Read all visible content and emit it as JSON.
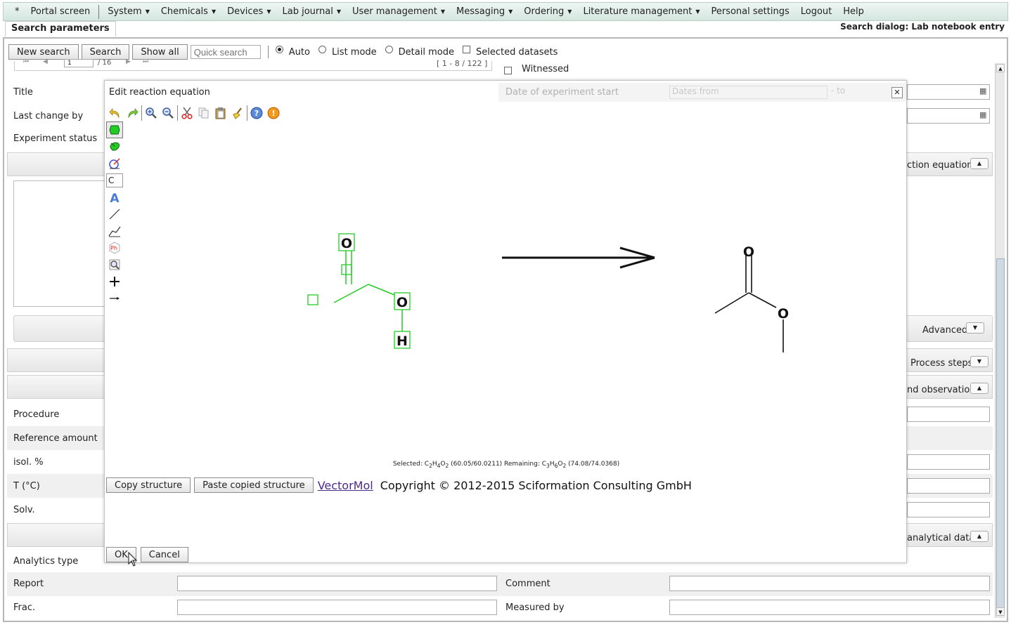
{
  "menu": {
    "items": [
      {
        "label": "*",
        "has_caret": false
      },
      {
        "label": "Portal screen",
        "has_caret": false
      },
      {
        "label": "System",
        "has_caret": true
      },
      {
        "label": "Chemicals",
        "has_caret": true
      },
      {
        "label": "Devices",
        "has_caret": true
      },
      {
        "label": "Lab journal",
        "has_caret": true
      },
      {
        "label": "User management",
        "has_caret": true
      },
      {
        "label": "Messaging",
        "has_caret": true
      },
      {
        "label": "Ordering",
        "has_caret": true
      },
      {
        "label": "Literature management",
        "has_caret": true
      },
      {
        "label": "Personal settings",
        "has_caret": false
      },
      {
        "label": "Logout",
        "has_caret": false
      },
      {
        "label": "Help",
        "has_caret": false
      }
    ]
  },
  "tabs": {
    "search_parameters": "Search parameters",
    "dialog_title": "Search dialog: Lab notebook entry"
  },
  "toolbar": {
    "new_search": "New search",
    "search": "Search",
    "show_all": "Show all",
    "quick_search_placeholder": "Quick search",
    "auto": "Auto",
    "list_mode": "List mode",
    "detail_mode": "Detail mode",
    "selected_datasets": "Selected datasets"
  },
  "pager": {
    "page": "1",
    "total_pages": "/ 16",
    "range": "[ 1 - 8 / 122 ]"
  },
  "form": {
    "witnessed": "Witnessed",
    "title": "Title",
    "last_change_by": "Last change by",
    "experiment_status": "Experiment status",
    "reaction_equation": "ction equation",
    "advanced": "Advanced",
    "process_steps": "Process steps",
    "observation": "nd observation",
    "procedure": "Procedure",
    "reference_amount": "Reference amount",
    "isol": "isol. %",
    "temp": "T (°C)",
    "solv": "Solv.",
    "analytical_data": "analytical data",
    "analytics_type": "Analytics type",
    "report": "Report",
    "comment": "Comment",
    "frac": "Frac.",
    "measured_by": "Measured by"
  },
  "dialog": {
    "title": "Edit reaction equation",
    "ghost_label": "Date of experiment start",
    "ghost_from": "Dates from",
    "ghost_to": "- to",
    "atom_symbol": "C",
    "atoms": {
      "o": "O",
      "h": "H"
    },
    "formula": {
      "selected_label": "Selected: ",
      "selected_formula": [
        "C",
        "2",
        "H",
        "4",
        "O",
        "2"
      ],
      "selected_mass": " (60.05/60.0211) ",
      "remaining_label": "Remaining: ",
      "remaining_formula": [
        "C",
        "3",
        "H",
        "6",
        "O",
        "2"
      ],
      "remaining_mass": " (74.08/74.0368)"
    },
    "copy_structure": "Copy structure",
    "paste_structure": "Paste copied structure",
    "vectormol_link": "VectorMol",
    "copyright": "Copyright © 2012-2015 Sciformation Consulting GmbH",
    "ok": "OK",
    "cancel": "Cancel"
  },
  "colors": {
    "selection_green": "#22cc22",
    "link_purple": "#4b2a8c"
  }
}
